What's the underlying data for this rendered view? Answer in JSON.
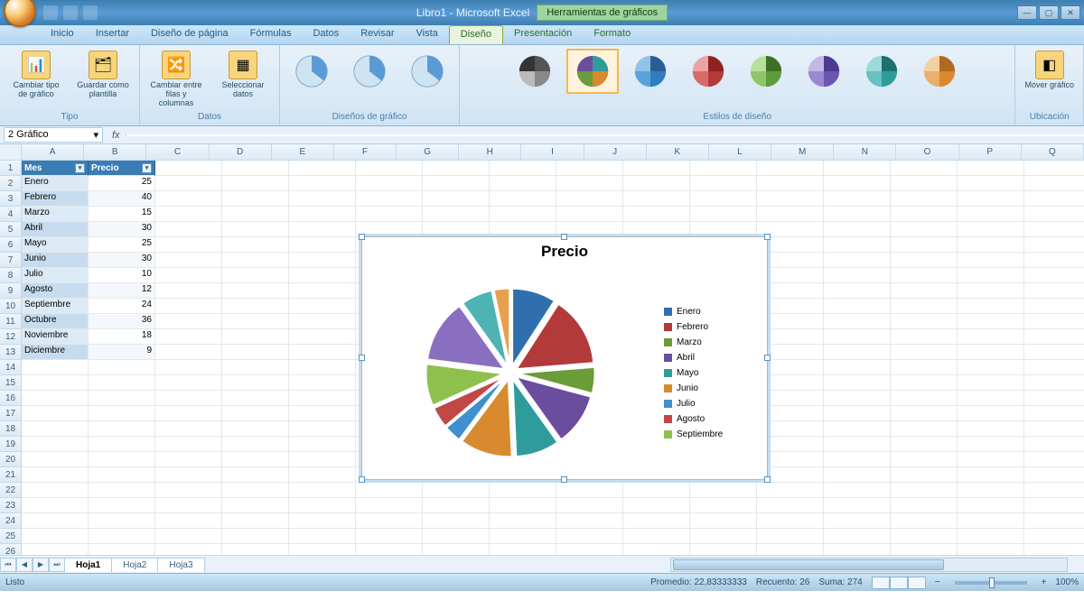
{
  "title": {
    "document": "Libro1 - Microsoft Excel",
    "context_tab": "Herramientas de gráficos"
  },
  "ribbon_tabs": [
    "Inicio",
    "Insertar",
    "Diseño de página",
    "Fórmulas",
    "Datos",
    "Revisar",
    "Vista"
  ],
  "ribbon_context_tabs": [
    "Diseño",
    "Presentación",
    "Formato"
  ],
  "ribbon_active_tab": "Diseño",
  "ribbon_groups": {
    "tipo": {
      "label": "Tipo",
      "btn1": "Cambiar tipo de gráfico",
      "btn2": "Guardar como plantilla"
    },
    "datos": {
      "label": "Datos",
      "btn1": "Cambiar entre filas y columnas",
      "btn2": "Seleccionar datos"
    },
    "disenos": {
      "label": "Diseños de gráfico"
    },
    "estilos": {
      "label": "Estilos de diseño"
    },
    "ubicacion": {
      "label": "Ubicación",
      "btn": "Mover gráfico"
    }
  },
  "style_palettes": [
    [
      "#555555",
      "#888888",
      "#bbbbbb",
      "#333333"
    ],
    [
      "#2f6fad",
      "#b33a3a",
      "#6a9c3a",
      "#6a4d9c",
      "#2f9c9c",
      "#d98a2f"
    ],
    [
      "#2a5d94",
      "#2f7fbf",
      "#5ba3d8",
      "#8fc4e8"
    ],
    [
      "#8f2323",
      "#b33a3a",
      "#d86a6a",
      "#eba3a3"
    ],
    [
      "#3f6f23",
      "#5d9c3a",
      "#8fc66a",
      "#b8e09c"
    ],
    [
      "#4d3a8f",
      "#6a55b3",
      "#9a88d1",
      "#c1b8e6"
    ],
    [
      "#1f7070",
      "#2f9c9c",
      "#66c1c1",
      "#9cdbdb"
    ],
    [
      "#b06a1f",
      "#d98a2f",
      "#eab06a",
      "#f4d1a3"
    ]
  ],
  "selected_style_index": 1,
  "namebox": "2 Gráfico",
  "columns": [
    "A",
    "B",
    "C",
    "D",
    "E",
    "F",
    "G",
    "H",
    "I",
    "J",
    "K",
    "L",
    "M",
    "N",
    "O",
    "P",
    "Q"
  ],
  "row_count": 26,
  "table": {
    "headers": [
      "Mes",
      "Precio"
    ],
    "rows": [
      [
        "Enero",
        25
      ],
      [
        "Febrero",
        40
      ],
      [
        "Marzo",
        15
      ],
      [
        "Abril",
        30
      ],
      [
        "Mayo",
        25
      ],
      [
        "Junio",
        30
      ],
      [
        "Julio",
        10
      ],
      [
        "Agosto",
        12
      ],
      [
        "Septiembre",
        24
      ],
      [
        "Octubre",
        36
      ],
      [
        "Noviembre",
        18
      ],
      [
        "Diciembre",
        9
      ]
    ]
  },
  "chart_data": {
    "type": "pie",
    "title": "Precio",
    "categories": [
      "Enero",
      "Febrero",
      "Marzo",
      "Abril",
      "Mayo",
      "Junio",
      "Julio",
      "Agosto",
      "Septiembre",
      "Octubre",
      "Noviembre",
      "Diciembre"
    ],
    "values": [
      25,
      40,
      15,
      30,
      25,
      30,
      10,
      12,
      24,
      36,
      18,
      9
    ],
    "colors": [
      "#2f6fad",
      "#b33a3a",
      "#6a9c3a",
      "#6a4d9c",
      "#2f9c9c",
      "#d98a2f",
      "#3f8fd1",
      "#c24848",
      "#8fc04d",
      "#8a6fc1",
      "#4db3b3",
      "#e8a04d"
    ],
    "legend_visible": [
      "Enero",
      "Febrero",
      "Marzo",
      "Abril",
      "Mayo",
      "Junio",
      "Julio",
      "Agosto",
      "Septiembre"
    ],
    "exploded": true
  },
  "sheets": {
    "tabs": [
      "Hoja1",
      "Hoja2",
      "Hoja3"
    ],
    "active": 0
  },
  "statusbar": {
    "mode": "Listo",
    "promedio_label": "Promedio:",
    "promedio_value": "22,83333333",
    "recuento_label": "Recuento:",
    "recuento_value": "26",
    "suma_label": "Suma:",
    "suma_value": "274",
    "zoom": "100%"
  }
}
